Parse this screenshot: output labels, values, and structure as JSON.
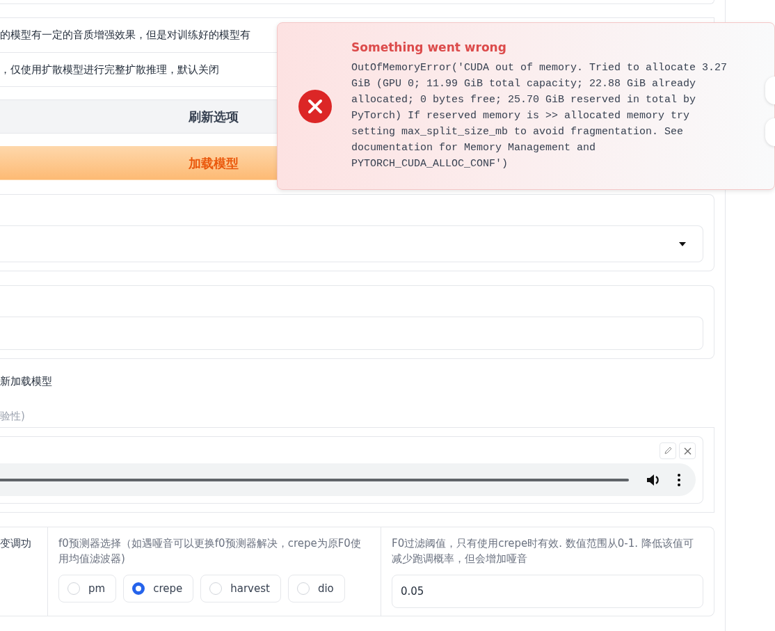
{
  "notes": [
    "的模型有一定的音质增强效果，但是对训练好的模型有",
    "，仅使用扩散模型进行完整扩散推理，默认关闭"
  ],
  "buttons": [
    {
      "label": "刷新选项",
      "kind": "secondary"
    },
    {
      "label": "加载模型",
      "kind": "primary"
    }
  ],
  "checkbox_label": "新加载模型",
  "audio": {
    "label": "验性)"
  },
  "params": [
    {
      "kind": "text",
      "label": "变调功"
    },
    {
      "kind": "radio",
      "label": "f0预测器选择（如遇哑音可以更换f0预测器解决，crepe为原F0使用均值滤波器)",
      "options": [
        {
          "label": "pm",
          "selected": false
        },
        {
          "label": "crepe",
          "selected": true
        },
        {
          "label": "harvest",
          "selected": false
        },
        {
          "label": "dio",
          "selected": false
        }
      ]
    },
    {
      "kind": "number",
      "label": "F0过滤阈值，只有使用crepe时有效. 数值范围从0-1. 降低该值可减少跑调概率，但会增加哑音",
      "value": "0.05"
    }
  ],
  "toast": {
    "title": "Something went wrong",
    "message": "OutOfMemoryError('CUDA out of memory. Tried to allocate 3.27 GiB (GPU 0; 11.99 GiB total capacity; 22.88 GiB already allocated; 0 bytes free; 25.70 GiB reserved in total by PyTorch) If reserved memory is >> allocated memory try setting max_split_size_mb to avoid fragmentation. See documentation for Memory Management and PYTORCH_CUDA_ALLOC_CONF')"
  }
}
